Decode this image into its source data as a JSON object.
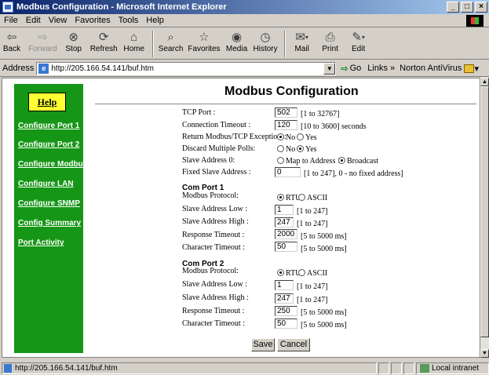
{
  "window": {
    "title": "Modbus Configuration - Microsoft Internet Explorer"
  },
  "menu": [
    "File",
    "Edit",
    "View",
    "Favorites",
    "Tools",
    "Help"
  ],
  "toolbar": {
    "back": "Back",
    "forward": "Forward",
    "stop": "Stop",
    "refresh": "Refresh",
    "home": "Home",
    "search": "Search",
    "favorites": "Favorites",
    "media": "Media",
    "history": "History",
    "mail": "Mail",
    "print": "Print",
    "edit": "Edit"
  },
  "address": {
    "label": "Address",
    "url": "http://205.166.54.141/buf.htm",
    "go": "Go",
    "links": "Links",
    "norton": "Norton AntiVirus"
  },
  "sidebar": {
    "help": "Help",
    "links": [
      "Configure Port 1",
      "Configure Port 2",
      "Configure Modbus",
      "Configure LAN",
      "Configure SNMP",
      "Config Summary",
      "Port Activity"
    ]
  },
  "page": {
    "title": "Modbus Configuration",
    "general": {
      "tcp_port": {
        "label": "TCP Port :",
        "value": "502",
        "hint": "[1 to 32767]"
      },
      "conn_timeout": {
        "label": "Connection Timeout :",
        "value": "120",
        "hint": "[10 to 3600] seconds"
      },
      "return_exceptions": {
        "label": "Return Modbus/TCP Exceptions:",
        "opt_no": "No",
        "opt_yes": "Yes",
        "selected": "No"
      },
      "discard_polls": {
        "label": "Discard Multiple Polls:",
        "opt_no": "No",
        "opt_yes": "Yes",
        "selected": "Yes"
      },
      "slave_addr0": {
        "label": "Slave Address 0:",
        "opt_map": "Map to Address 1",
        "opt_broadcast": "Broadcast",
        "selected": "Broadcast"
      },
      "fixed_slave": {
        "label": "Fixed Slave Address :",
        "value": "0",
        "hint": "[1 to 247], 0 - no fixed address]"
      }
    },
    "com1": {
      "heading": "Com Port 1",
      "protocol": {
        "label": "Modbus Protocol:",
        "opt_rtu": "RTU",
        "opt_ascii": "ASCII",
        "selected": "RTU"
      },
      "slave_low": {
        "label": "Slave Address Low :",
        "value": "1",
        "hint": "[1 to 247]"
      },
      "slave_high": {
        "label": "Slave Address High :",
        "value": "247",
        "hint": "[1 to 247]"
      },
      "resp_timeout": {
        "label": "Response Timeout :",
        "value": "2000",
        "hint": "[5 to 5000 ms]"
      },
      "char_timeout": {
        "label": "Character Timeout :",
        "value": "50",
        "hint": "[5 to 5000 ms]"
      }
    },
    "com2": {
      "heading": "Com Port 2",
      "protocol": {
        "label": "Modbus Protocol:",
        "opt_rtu": "RTU",
        "opt_ascii": "ASCII",
        "selected": "RTU"
      },
      "slave_low": {
        "label": "Slave Address Low :",
        "value": "1",
        "hint": "[1 to 247]"
      },
      "slave_high": {
        "label": "Slave Address High :",
        "value": "247",
        "hint": "[1 to 247]"
      },
      "resp_timeout": {
        "label": "Response Timeout :",
        "value": "250",
        "hint": "[5 to 5000 ms]"
      },
      "char_timeout": {
        "label": "Character Timeout :",
        "value": "50",
        "hint": "[5 to 5000 ms]"
      }
    },
    "save": "Save",
    "cancel": "Cancel"
  },
  "status": {
    "url": "http://205.166.54.141/buf.htm",
    "zone": "Local intranet"
  }
}
